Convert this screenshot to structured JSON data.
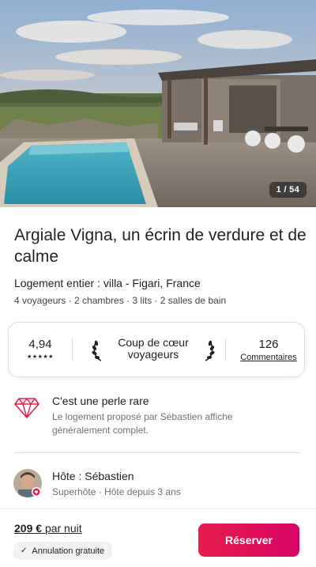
{
  "gallery": {
    "counter": "1 / 54",
    "photo": "villa-pool-photo"
  },
  "listing": {
    "title": "Argiale Vigna, un écrin de verdure et de calme",
    "subtitle": "Logement entier : villa - Figari, France",
    "details": "4 voyageurs · 2 chambres · 3 lits · 2 salles de bain"
  },
  "stats": {
    "rating": "4,94",
    "stars": "★★★★★",
    "favorite_label": "Coup de cœur voyageurs",
    "reviews_count": "126",
    "reviews_label": "Commentaires"
  },
  "highlight": {
    "icon": "gem-icon",
    "title": "C'est une perle rare",
    "description": "Le logement proposé par Sébastien affiche généralement complet."
  },
  "host": {
    "title": "Hôte : Sébastien",
    "subtitle": "Superhôte · Hôte depuis 3 ans"
  },
  "footer": {
    "price": "209 €",
    "price_suffix": "par nuit",
    "cancellation": "Annulation gratuite",
    "reserve_label": "Réserver"
  },
  "colors": {
    "brand": "#e61e4d",
    "brand_end": "#d70466",
    "text": "#222222",
    "muted": "#717171",
    "border": "#dddddd"
  }
}
